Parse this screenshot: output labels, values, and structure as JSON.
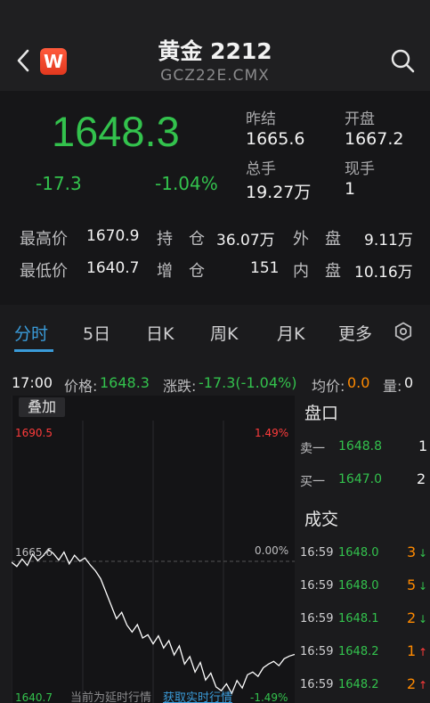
{
  "header": {
    "title": "黄金 2212",
    "subtitle": "GCZ22E.CMX",
    "logo_letter": "W"
  },
  "quote": {
    "price": "1648.3",
    "change": "-17.3",
    "change_pct": "-1.04%",
    "prev_close_label": "昨结",
    "prev_close": "1665.6",
    "open_label": "开盘",
    "open": "1667.2",
    "volume_label": "总手",
    "volume": "19.27万",
    "current_hand_label": "现手",
    "current_hand": "1"
  },
  "stats": {
    "high_label": "最高价",
    "high": "1670.9",
    "hold_label": "持　仓",
    "hold": "36.07万",
    "outer_label": "外　盘",
    "outer": "9.11万",
    "low_label": "最低价",
    "low": "1640.7",
    "add_label": "增　仓",
    "add": "151",
    "inner_label": "内　盘",
    "inner": "10.16万"
  },
  "tabs": [
    "分时",
    "5日",
    "日K",
    "周K",
    "月K",
    "更多"
  ],
  "infobar": {
    "time": "17:00",
    "price_label": "价格:",
    "price": "1648.3",
    "change_label": "涨跌:",
    "change": "-17.3(-1.04%)",
    "avg_label": "均价:",
    "avg": "0.0",
    "vol_label": "量:",
    "vol": "0"
  },
  "chart": {
    "overlay_label": "叠加",
    "y_top": "1690.5",
    "y_mid": "1665.6",
    "y_bottom": "1640.7",
    "pct_top": "1.49%",
    "pct_mid": "0.00%",
    "pct_bottom": "-1.49%",
    "delay_text": "当前为延时行情",
    "realtime_link": "获取实时行情"
  },
  "chart_data": {
    "type": "line",
    "title": "",
    "ylim": [
      1640.7,
      1690.5
    ],
    "y": [
      1665.6,
      1664.8,
      1666.2,
      1665.0,
      1667.1,
      1665.9,
      1666.8,
      1668.0,
      1667.2,
      1666.0,
      1667.5,
      1665.3,
      1666.9,
      1665.8,
      1666.4,
      1665.1,
      1664.0,
      1662.5,
      1660.0,
      1657.5,
      1655.0,
      1656.2,
      1653.8,
      1652.5,
      1653.9,
      1651.4,
      1652.0,
      1650.3,
      1651.8,
      1649.5,
      1650.9,
      1648.2,
      1649.9,
      1646.5,
      1647.9,
      1645.0,
      1646.8,
      1643.5,
      1644.8,
      1642.2,
      1641.5,
      1642.8,
      1641.0,
      1643.4,
      1642.0,
      1644.5,
      1645.0,
      1644.2,
      1645.8,
      1646.5,
      1647.0,
      1646.2,
      1647.5,
      1648.0,
      1648.3
    ]
  },
  "order_book": {
    "title": "盘口",
    "rows": [
      {
        "label": "卖一",
        "price": "1648.8",
        "qty": "1"
      },
      {
        "label": "买一",
        "price": "1647.0",
        "qty": "2"
      }
    ]
  },
  "trades": {
    "title": "成交",
    "rows": [
      {
        "time": "16:59",
        "price": "1648.0",
        "qty": "3",
        "dir": "↓"
      },
      {
        "time": "16:59",
        "price": "1648.0",
        "qty": "5",
        "dir": "↓"
      },
      {
        "time": "16:59",
        "price": "1648.1",
        "qty": "2",
        "dir": "↓"
      },
      {
        "time": "16:59",
        "price": "1648.2",
        "qty": "1",
        "dir": "↑"
      },
      {
        "time": "16:59",
        "price": "1648.2",
        "qty": "2",
        "dir": "↑"
      }
    ]
  },
  "colors": {
    "down": "#33c24d",
    "up": "#ff3b3b",
    "accent": "#3a9bd9",
    "qty": "#ff8a00",
    "logo": "#e2381f"
  },
  "icons": {
    "back": "chevron-left-icon",
    "search": "search-icon",
    "settings": "settings-icon"
  }
}
